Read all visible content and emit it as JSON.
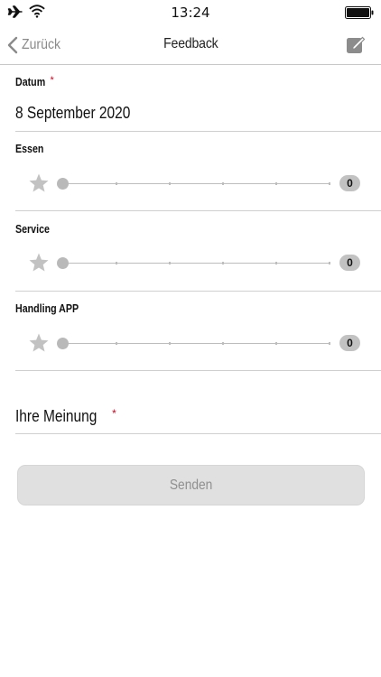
{
  "status_bar": {
    "time": "13:24",
    "icons": [
      "airplane-icon",
      "wifi-icon",
      "battery-icon"
    ]
  },
  "nav": {
    "back_label": "Zurück",
    "title": "Feedback",
    "back_icon": "chevron-left-icon",
    "edit_icon": "compose-icon",
    "back_color": "#8a8a8a"
  },
  "form": {
    "date": {
      "label": "Datum",
      "required_mark": "*",
      "value": "8 September 2020"
    },
    "ratings": [
      {
        "label": "Essen",
        "value": "0",
        "slider_value": 0,
        "slider_max": 5
      },
      {
        "label": "Service",
        "value": "0",
        "slider_value": 0,
        "slider_max": 5
      },
      {
        "label": "Handling APP",
        "value": "0",
        "slider_value": 0,
        "slider_max": 5
      }
    ],
    "opinion": {
      "label": "Ihre Meinung",
      "required_mark": "*"
    },
    "submit_label": "Senden"
  },
  "colors": {
    "required": "#d0021b",
    "button_bg": "#e0e0e0",
    "button_text": "#8f8f8f",
    "slider_thumb": "#b9b9b9"
  }
}
